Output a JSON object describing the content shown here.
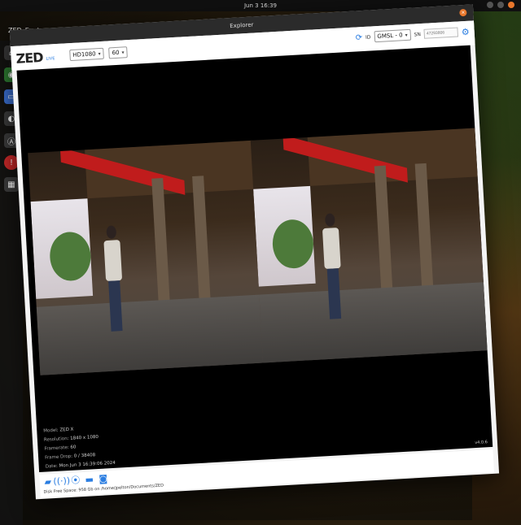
{
  "desktop": {
    "clock": "Jun 3  16:39",
    "app_menu": "ZED_Explorer"
  },
  "window": {
    "title": "Explorer",
    "close_glyph": "×"
  },
  "toolbar": {
    "logo": "ZED",
    "live": "LIVE",
    "resolution": "HD1080",
    "fps": "60",
    "id_label": "ID",
    "camera": "GMSL - 0",
    "sn_label": "SN",
    "sn_placeholder": "47293806"
  },
  "info": {
    "rows": [
      {
        "key": "Model",
        "value": "ZED X"
      },
      {
        "key": "Resolution",
        "value": "1840 x 1080"
      },
      {
        "key": "Framerate",
        "value": "60"
      },
      {
        "key": "Frame Drop",
        "value": "0 / 38408"
      },
      {
        "key": "Date",
        "value": "Mon Jun 3 16:39:06 2024"
      }
    ]
  },
  "version": "v4.0.6",
  "status": {
    "disk": "Disk Free Space: 958 Gb on /home/jpelton/Documents/ZED"
  },
  "colors": {
    "accent": "#2a7de1",
    "titlebar": "#2b2b2b",
    "close": "#e9772c"
  },
  "icons": {
    "folder": "folder-icon",
    "stream": "stream-icon",
    "depth": "depth-icon",
    "record": "record-icon",
    "snapshot": "camera-icon"
  }
}
